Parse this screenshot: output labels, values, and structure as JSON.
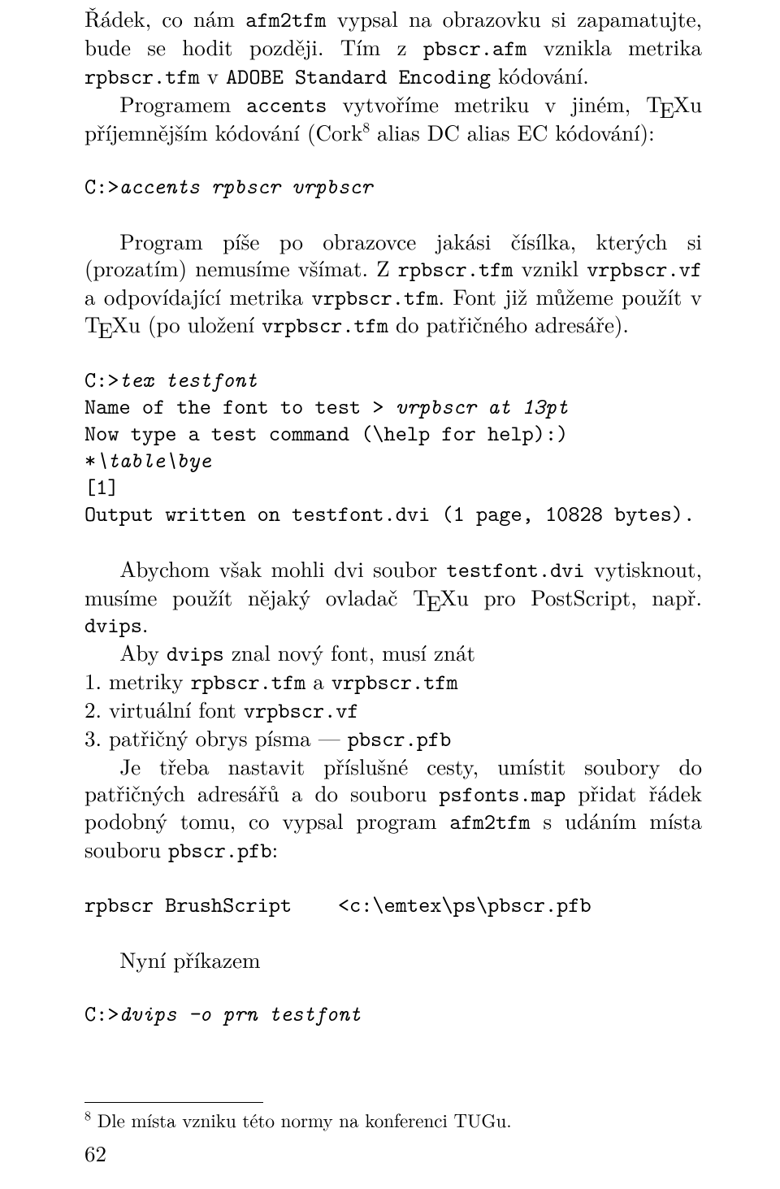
{
  "p1a": "Řádek, co nám ",
  "p1b": "afm2tfm",
  "p1c": " vypsal na obrazovku si zapamatujte, bude se hodit později. Tím z ",
  "p1d": "pbscr.afm",
  "p1e": " vznikla metrika ",
  "p1f": "rpbscr.tfm",
  "p1g": " v ",
  "p1h": "ADOBE Standard Encoding",
  "p1i": " kódování.",
  "p2a": "Programem ",
  "p2b": "accents",
  "p2c1": " vytvoříme metriku v jiném, ",
  "texT1": "T",
  "texE1": "E",
  "texX1": "X",
  "p2c2": "u příjemnějším kódování (Cork",
  "p2fn": "8",
  "p2d": " alias DC alias EC kódování):",
  "cmd1a": "C:>",
  "cmd1b": "accents rpbscr vrpbscr",
  "p3a": "Program píše po obrazovce jakási čísílka, kterých si (prozatím) nemusíme všímat. Z ",
  "p3b": "rpbscr.tfm",
  "p3c": " vznikl ",
  "p3d": "vrpbscr.vf",
  "p3e": " a odpovídající metrika ",
  "p3f": "vrpbscr.tfm",
  "p3g1": ". Font již můžeme použít v ",
  "texT2": "T",
  "texE2": "E",
  "texX2": "X",
  "p3g2": "u (po uložení ",
  "p3h": "vrpbscr.tfm",
  "p3i": " do patřičného adresáře).",
  "tt1a": "C:>",
  "tt1b": "tex testfont",
  "tt2a": "Name of the font to test > ",
  "tt2b": "vrpbscr at 13pt",
  "tt3": "Now type a test command (\\help for help):)",
  "tt4a": "*",
  "tt4b": "\\table\\bye",
  "tt5": "[1]",
  "tt6": "Output written on testfont.dvi (1 page, 10828 bytes).",
  "p4a": "Abychom však mohli dvi soubor ",
  "p4b": "testfont.dvi",
  "p4c1": " vytisknout, musíme použít nějaký ovladač ",
  "texT3": "T",
  "texE3": "E",
  "texX3": "X",
  "p4c2": "u pro PostScript, např. ",
  "p4d": "dvips",
  "p4e": ".",
  "p5a": "Aby ",
  "p5b": "dvips",
  "p5c": " znal nový font, musí znát",
  "li1a": "1. metriky ",
  "li1b": "rpbscr.tfm",
  "li1c": " a ",
  "li1d": "vrpbscr.tfm",
  "li2a": "2. virtuální font ",
  "li2b": "vrpbscr.vf",
  "li3a": "3. patřičný obrys písma — ",
  "li3b": "pbscr.pfb",
  "p6a": "Je třeba nastavit příslušné cesty, umístit soubory do patřičných adresářů a do souboru ",
  "p6b": "psfonts.map",
  "p6c": " přidat řádek podobný tomu, co vypsal program ",
  "p6d": "afm2tfm",
  "p6e": " s udáním místa souboru ",
  "p6f": "pbscr.pfb",
  "p6g": ":",
  "map": "rpbscr BrushScript    <c:\\emtex\\ps\\pbscr.pfb",
  "p7": "Nyní příkazem",
  "cmd2a": "C:>",
  "cmd2b": "dvips -o prn testfont",
  "fnMark": "8",
  "fnText": " Dle místa vzniku této normy na konferenci TUGu.",
  "pageNumber": "62"
}
